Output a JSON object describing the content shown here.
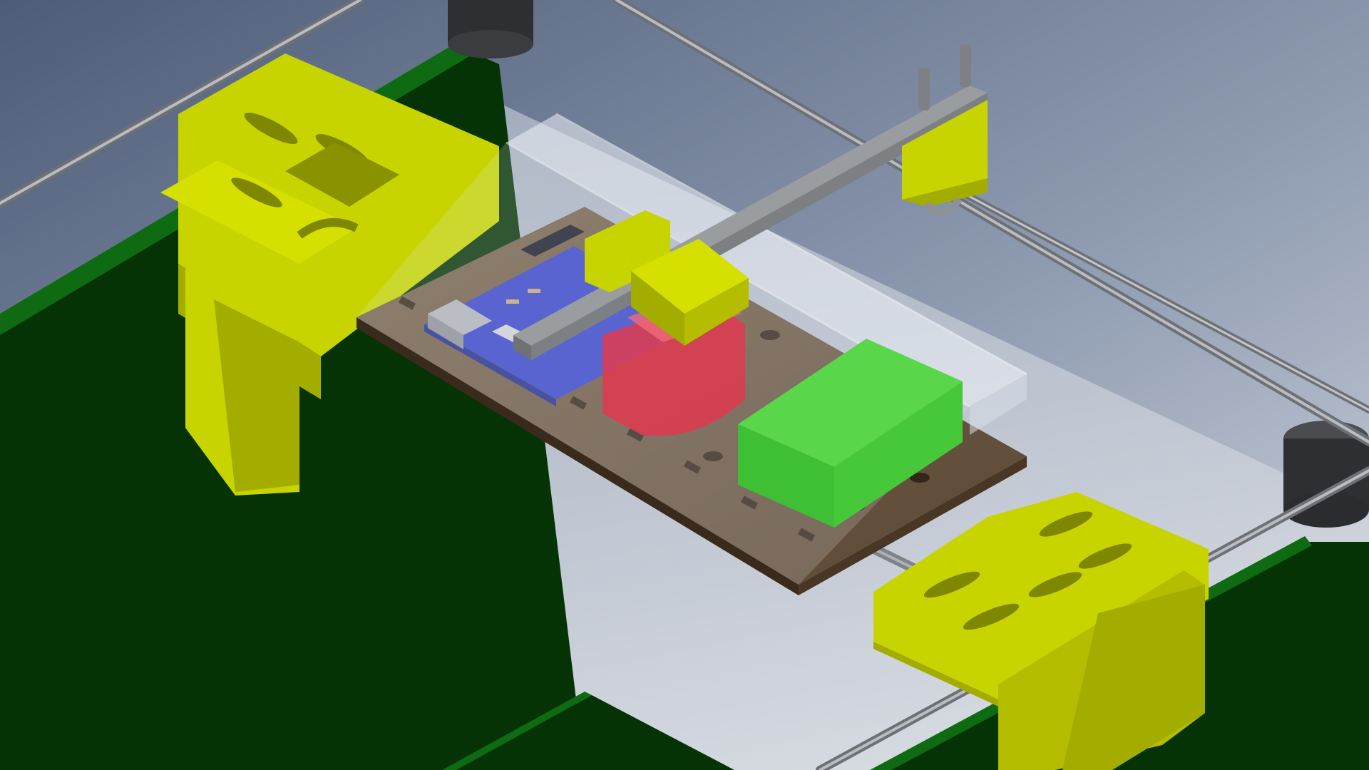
{
  "scene": {
    "view": "isometric-cad-render",
    "colors": {
      "background_top": "#4f5c78",
      "background_bottom": "#c9cfd8",
      "frame_panel": "#063306",
      "frame_panel_edge": "#0f6b12",
      "clamp": "#c8d400",
      "clamp_shade": "#a3ad00",
      "clamp_dark": "#8a9200",
      "rod": "#8e9296",
      "rod_highlight": "#c3c6c9",
      "base_board": "#6e5a44",
      "base_board_edge": "#3a2a1c",
      "microcontroller_board": "#3a45c8",
      "acrylic_cover": "#e6ecf4",
      "red_holder": "#e0394f",
      "green_battery": "#4ccf3c",
      "foot": "#3a3c40",
      "slider_bar": "#9a9da0"
    }
  }
}
